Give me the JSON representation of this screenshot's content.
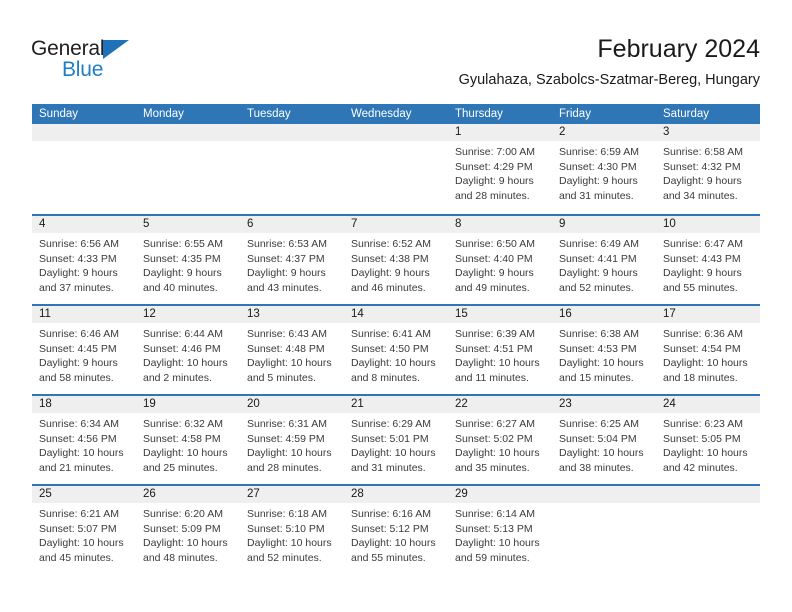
{
  "brand": {
    "name_top": "General",
    "name_bottom": "Blue",
    "accent_color": "#1f7ec4"
  },
  "header": {
    "title": "February 2024",
    "subtitle": "Gyulahaza, Szabolcs-Szatmar-Bereg, Hungary"
  },
  "colors": {
    "header_blue": "#2e76b6",
    "day_band_gray": "#efefef",
    "text": "#1a1a1a"
  },
  "weekdays": [
    "Sunday",
    "Monday",
    "Tuesday",
    "Wednesday",
    "Thursday",
    "Friday",
    "Saturday"
  ],
  "weeks": [
    [
      {
        "day": "",
        "sunrise": "",
        "sunset": "",
        "daylight": "",
        "empty": true
      },
      {
        "day": "",
        "sunrise": "",
        "sunset": "",
        "daylight": "",
        "empty": true
      },
      {
        "day": "",
        "sunrise": "",
        "sunset": "",
        "daylight": "",
        "empty": true
      },
      {
        "day": "",
        "sunrise": "",
        "sunset": "",
        "daylight": "",
        "empty": true
      },
      {
        "day": "1",
        "sunrise": "Sunrise: 7:00 AM",
        "sunset": "Sunset: 4:29 PM",
        "daylight": "Daylight: 9 hours and 28 minutes."
      },
      {
        "day": "2",
        "sunrise": "Sunrise: 6:59 AM",
        "sunset": "Sunset: 4:30 PM",
        "daylight": "Daylight: 9 hours and 31 minutes."
      },
      {
        "day": "3",
        "sunrise": "Sunrise: 6:58 AM",
        "sunset": "Sunset: 4:32 PM",
        "daylight": "Daylight: 9 hours and 34 minutes."
      }
    ],
    [
      {
        "day": "4",
        "sunrise": "Sunrise: 6:56 AM",
        "sunset": "Sunset: 4:33 PM",
        "daylight": "Daylight: 9 hours and 37 minutes."
      },
      {
        "day": "5",
        "sunrise": "Sunrise: 6:55 AM",
        "sunset": "Sunset: 4:35 PM",
        "daylight": "Daylight: 9 hours and 40 minutes."
      },
      {
        "day": "6",
        "sunrise": "Sunrise: 6:53 AM",
        "sunset": "Sunset: 4:37 PM",
        "daylight": "Daylight: 9 hours and 43 minutes."
      },
      {
        "day": "7",
        "sunrise": "Sunrise: 6:52 AM",
        "sunset": "Sunset: 4:38 PM",
        "daylight": "Daylight: 9 hours and 46 minutes."
      },
      {
        "day": "8",
        "sunrise": "Sunrise: 6:50 AM",
        "sunset": "Sunset: 4:40 PM",
        "daylight": "Daylight: 9 hours and 49 minutes."
      },
      {
        "day": "9",
        "sunrise": "Sunrise: 6:49 AM",
        "sunset": "Sunset: 4:41 PM",
        "daylight": "Daylight: 9 hours and 52 minutes."
      },
      {
        "day": "10",
        "sunrise": "Sunrise: 6:47 AM",
        "sunset": "Sunset: 4:43 PM",
        "daylight": "Daylight: 9 hours and 55 minutes."
      }
    ],
    [
      {
        "day": "11",
        "sunrise": "Sunrise: 6:46 AM",
        "sunset": "Sunset: 4:45 PM",
        "daylight": "Daylight: 9 hours and 58 minutes."
      },
      {
        "day": "12",
        "sunrise": "Sunrise: 6:44 AM",
        "sunset": "Sunset: 4:46 PM",
        "daylight": "Daylight: 10 hours and 2 minutes."
      },
      {
        "day": "13",
        "sunrise": "Sunrise: 6:43 AM",
        "sunset": "Sunset: 4:48 PM",
        "daylight": "Daylight: 10 hours and 5 minutes."
      },
      {
        "day": "14",
        "sunrise": "Sunrise: 6:41 AM",
        "sunset": "Sunset: 4:50 PM",
        "daylight": "Daylight: 10 hours and 8 minutes."
      },
      {
        "day": "15",
        "sunrise": "Sunrise: 6:39 AM",
        "sunset": "Sunset: 4:51 PM",
        "daylight": "Daylight: 10 hours and 11 minutes."
      },
      {
        "day": "16",
        "sunrise": "Sunrise: 6:38 AM",
        "sunset": "Sunset: 4:53 PM",
        "daylight": "Daylight: 10 hours and 15 minutes."
      },
      {
        "day": "17",
        "sunrise": "Sunrise: 6:36 AM",
        "sunset": "Sunset: 4:54 PM",
        "daylight": "Daylight: 10 hours and 18 minutes."
      }
    ],
    [
      {
        "day": "18",
        "sunrise": "Sunrise: 6:34 AM",
        "sunset": "Sunset: 4:56 PM",
        "daylight": "Daylight: 10 hours and 21 minutes."
      },
      {
        "day": "19",
        "sunrise": "Sunrise: 6:32 AM",
        "sunset": "Sunset: 4:58 PM",
        "daylight": "Daylight: 10 hours and 25 minutes."
      },
      {
        "day": "20",
        "sunrise": "Sunrise: 6:31 AM",
        "sunset": "Sunset: 4:59 PM",
        "daylight": "Daylight: 10 hours and 28 minutes."
      },
      {
        "day": "21",
        "sunrise": "Sunrise: 6:29 AM",
        "sunset": "Sunset: 5:01 PM",
        "daylight": "Daylight: 10 hours and 31 minutes."
      },
      {
        "day": "22",
        "sunrise": "Sunrise: 6:27 AM",
        "sunset": "Sunset: 5:02 PM",
        "daylight": "Daylight: 10 hours and 35 minutes."
      },
      {
        "day": "23",
        "sunrise": "Sunrise: 6:25 AM",
        "sunset": "Sunset: 5:04 PM",
        "daylight": "Daylight: 10 hours and 38 minutes."
      },
      {
        "day": "24",
        "sunrise": "Sunrise: 6:23 AM",
        "sunset": "Sunset: 5:05 PM",
        "daylight": "Daylight: 10 hours and 42 minutes."
      }
    ],
    [
      {
        "day": "25",
        "sunrise": "Sunrise: 6:21 AM",
        "sunset": "Sunset: 5:07 PM",
        "daylight": "Daylight: 10 hours and 45 minutes."
      },
      {
        "day": "26",
        "sunrise": "Sunrise: 6:20 AM",
        "sunset": "Sunset: 5:09 PM",
        "daylight": "Daylight: 10 hours and 48 minutes."
      },
      {
        "day": "27",
        "sunrise": "Sunrise: 6:18 AM",
        "sunset": "Sunset: 5:10 PM",
        "daylight": "Daylight: 10 hours and 52 minutes."
      },
      {
        "day": "28",
        "sunrise": "Sunrise: 6:16 AM",
        "sunset": "Sunset: 5:12 PM",
        "daylight": "Daylight: 10 hours and 55 minutes."
      },
      {
        "day": "29",
        "sunrise": "Sunrise: 6:14 AM",
        "sunset": "Sunset: 5:13 PM",
        "daylight": "Daylight: 10 hours and 59 minutes."
      },
      {
        "day": "",
        "sunrise": "",
        "sunset": "",
        "daylight": "",
        "empty": true
      },
      {
        "day": "",
        "sunrise": "",
        "sunset": "",
        "daylight": "",
        "empty": true
      }
    ]
  ]
}
